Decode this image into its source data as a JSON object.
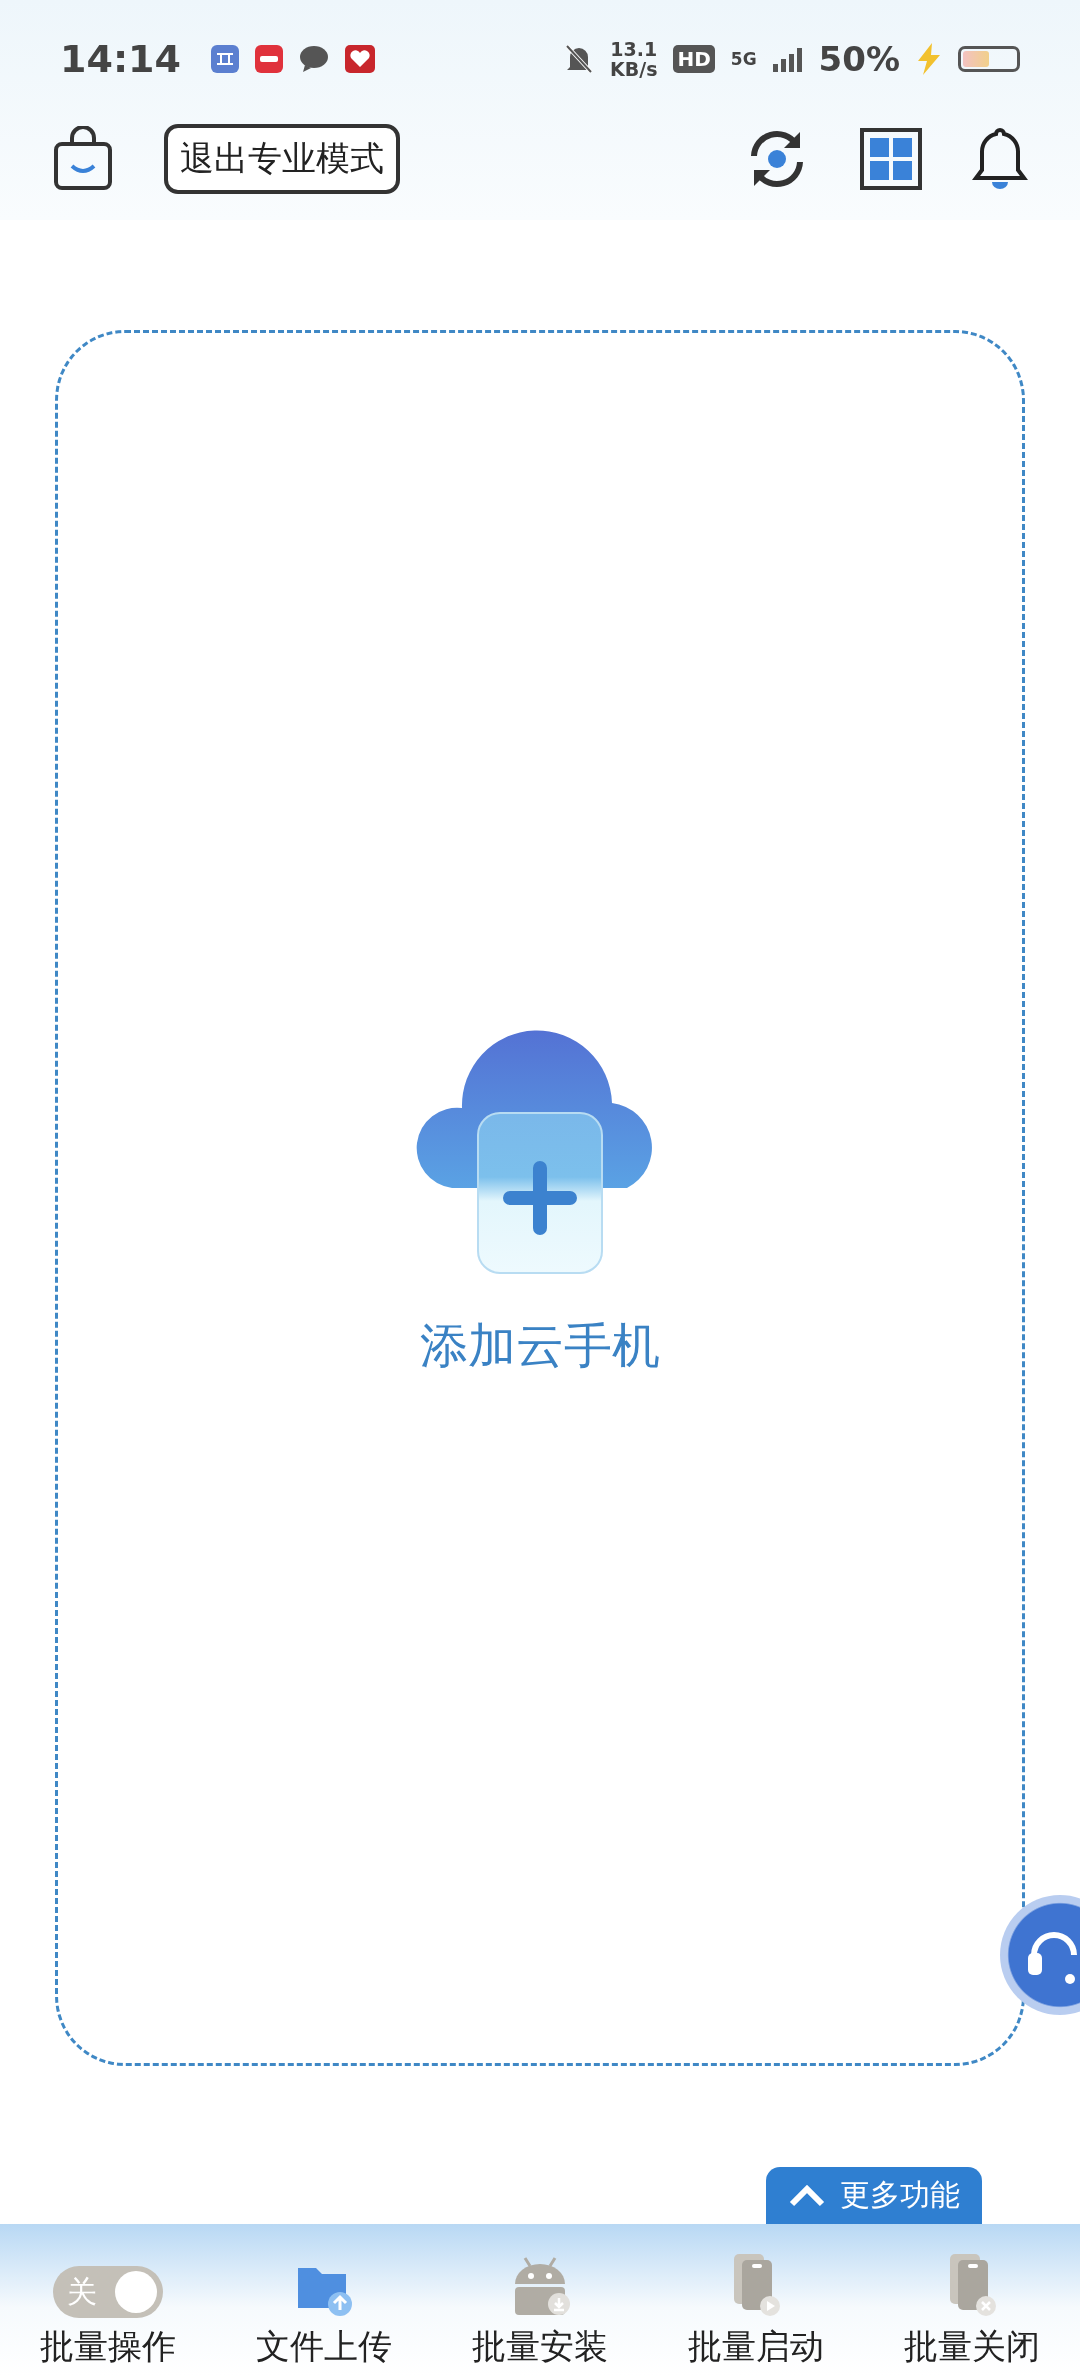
{
  "status_bar": {
    "time": "14:14",
    "net_speed": "13.1",
    "net_unit": "KB/s",
    "hd": "HD",
    "network": "5G",
    "battery": "50%",
    "battery_icon": {
      "level": 0.5
    }
  },
  "top_bar": {
    "exit_button": "退出专业模式"
  },
  "add_card": {
    "label": "添加云手机"
  },
  "more_button": {
    "label": "更多功能"
  },
  "bottom_bar": {
    "items": [
      {
        "kind": "toggle",
        "label": "批量操作",
        "toggle_text": "关",
        "on": false
      },
      {
        "kind": "upload",
        "label": "文件上传"
      },
      {
        "kind": "install",
        "label": "批量安装"
      },
      {
        "kind": "start",
        "label": "批量启动"
      },
      {
        "kind": "close",
        "label": "批量关闭"
      }
    ]
  }
}
